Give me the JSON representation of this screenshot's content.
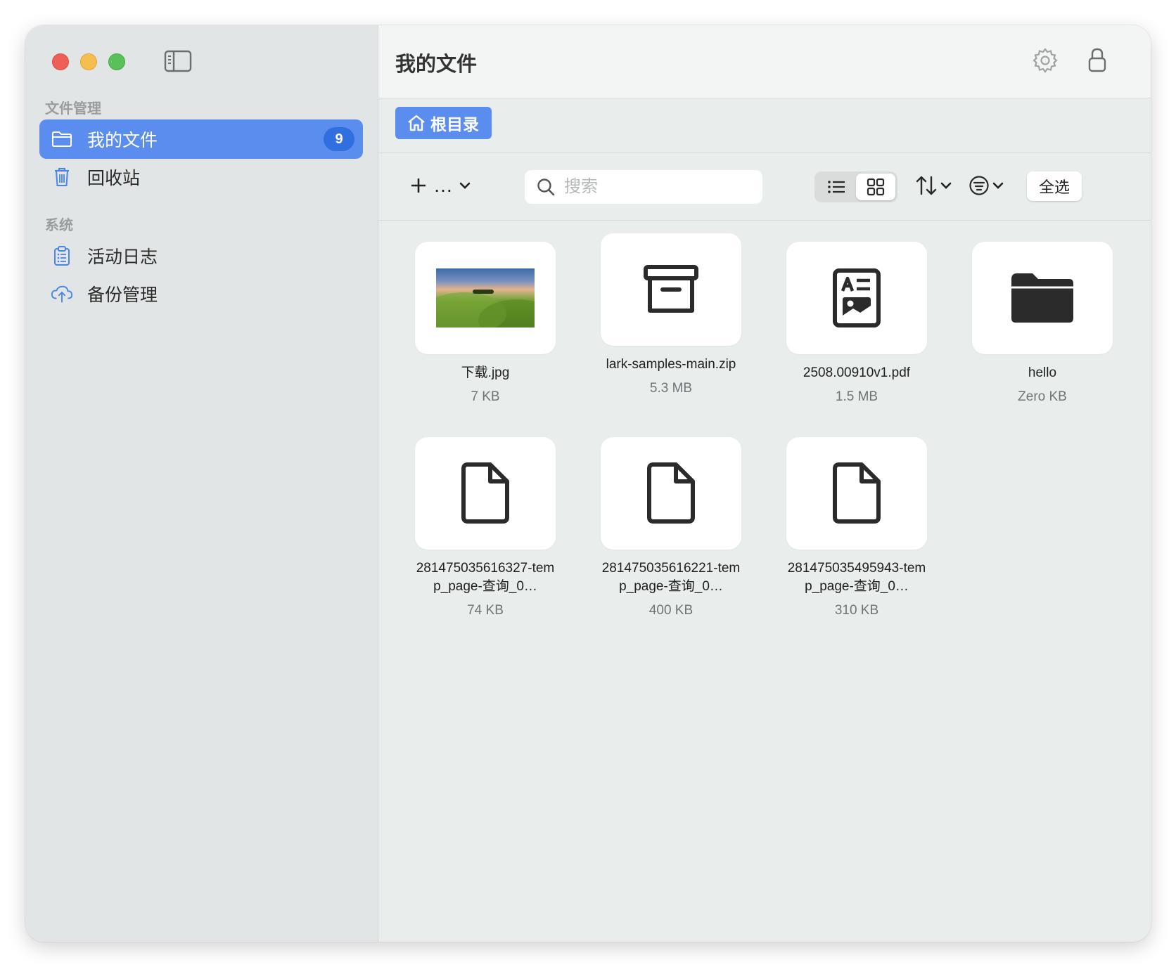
{
  "sidebar": {
    "section_files": "文件管理",
    "section_system": "系统",
    "items": [
      {
        "label": "我的文件",
        "badge": "9",
        "icon": "folder-icon"
      },
      {
        "label": "回收站",
        "icon": "trash-icon"
      },
      {
        "label": "活动日志",
        "icon": "clipboard-list-icon"
      },
      {
        "label": "备份管理",
        "icon": "cloud-upload-icon"
      }
    ]
  },
  "header": {
    "title": "我的文件"
  },
  "breadcrumb": {
    "root_label": "根目录"
  },
  "toolbar": {
    "new_label": "…",
    "search_placeholder": "搜索",
    "select_all_label": "全选"
  },
  "files": [
    {
      "name": "下载.jpg",
      "size": "7 KB",
      "type": "image"
    },
    {
      "name": "lark-samples-main.zip",
      "size": "5.3 MB",
      "type": "archive"
    },
    {
      "name": "2508.00910v1.pdf",
      "size": "1.5 MB",
      "type": "pdf"
    },
    {
      "name": "hello",
      "size": "Zero KB",
      "type": "folder"
    },
    {
      "name": "281475035616327-temp_page-查询_0…",
      "size": "74 KB",
      "type": "document"
    },
    {
      "name": "281475035616221-temp_page-查询_0…",
      "size": "400 KB",
      "type": "document"
    },
    {
      "name": "281475035495943-temp_page-查询_0…",
      "size": "310 KB",
      "type": "document"
    }
  ],
  "colors": {
    "accent": "#5b8def",
    "badge": "#2f6fe0",
    "sidebar_bg": "#e2e5e5",
    "content_bg": "#e9edeb"
  }
}
